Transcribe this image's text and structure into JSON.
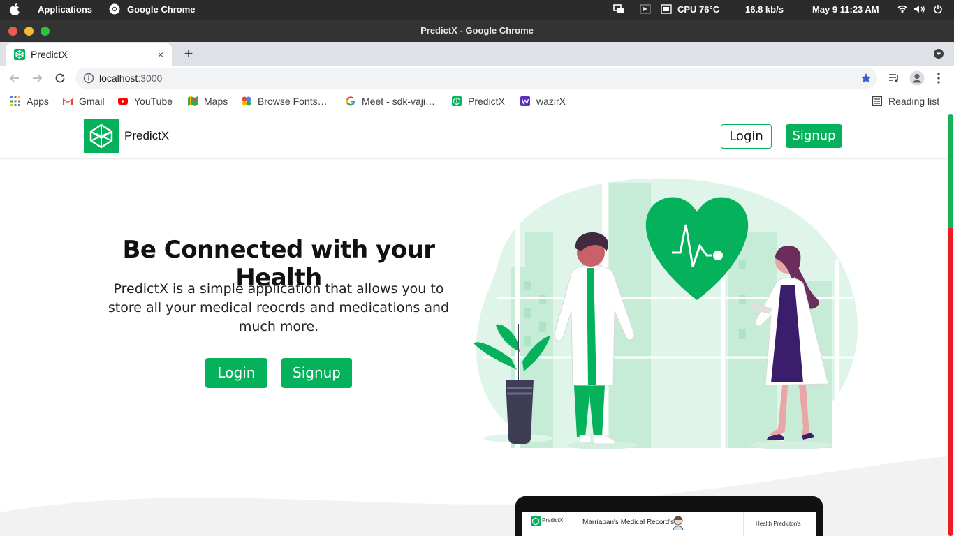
{
  "os": {
    "apps_label": "Applications",
    "active_app": "Google Chrome",
    "cpu": "CPU 76°C",
    "net_speed": "16.8 kb/s",
    "clock": "May 9  11:23 AM"
  },
  "window": {
    "title": "PredictX - Google Chrome"
  },
  "tab": {
    "label": "PredictX",
    "close": "×",
    "new_tab": "+"
  },
  "toolbar": {
    "url_host": "localhost",
    "url_port": ":3000"
  },
  "bookmarks": {
    "apps": "Apps",
    "gmail": "Gmail",
    "youtube": "YouTube",
    "maps": "Maps",
    "fonts": "Browse Fonts…",
    "meet": "Meet - sdk-vaji…",
    "predictx": "PredictX",
    "wazirx": "wazirX",
    "reading_list": "Reading list"
  },
  "navbar": {
    "brand": "PredictX",
    "login": "Login",
    "signup": "Signup"
  },
  "hero": {
    "title": "Be Connected with your Health",
    "description": "PredictX is a simple application that allows you to store all your medical reocrds and medications and much more.",
    "login": "Login",
    "signup": "Signup"
  },
  "preview": {
    "brand": "PredictX",
    "records_title": "Marriapan's Medical Record's",
    "prediction": "Health Predicton's"
  },
  "colors": {
    "brand_green": "#06b15b",
    "os_bar": "#2b2b2b",
    "title_bar": "#333333",
    "tab_strip": "#dee1e6"
  }
}
